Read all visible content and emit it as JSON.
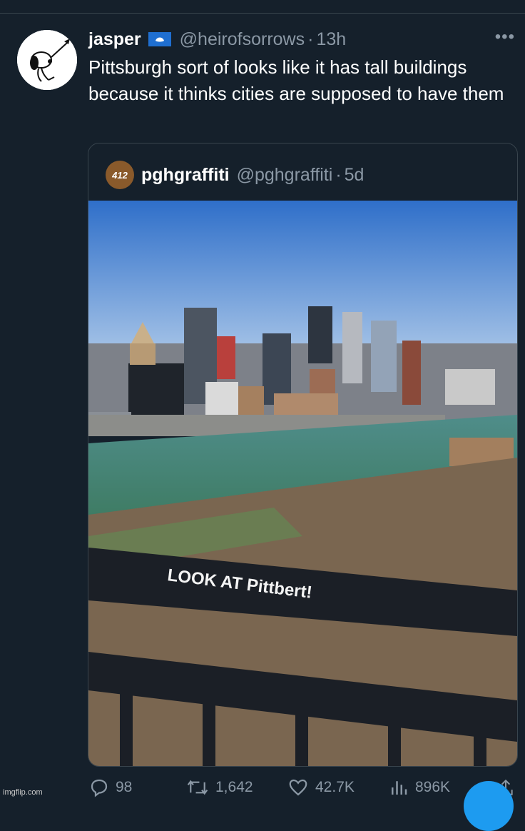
{
  "tweet": {
    "display_name": "jasper",
    "handle": "@heirofsorrows",
    "separator": "·",
    "time": "13h",
    "more_label": "•••",
    "text": "Pittsburgh sort of looks like it has tall buildings because it thinks cities are supposed to have them"
  },
  "quote": {
    "avatar_text": "412",
    "display_name": "pghgraffiti",
    "handle": "@pghgraffiti",
    "separator": "·",
    "time": "5d",
    "photo_graffiti_text": "LOOK AT Pittbert!"
  },
  "actions": {
    "replies": "98",
    "retweets": "1,642",
    "likes": "42.7K",
    "views": "896K"
  },
  "watermark": "imgflip.com",
  "colors": {
    "background": "#15202b",
    "secondary_text": "#8b98a5",
    "border": "#38444d",
    "accent": "#1d9bf0"
  }
}
